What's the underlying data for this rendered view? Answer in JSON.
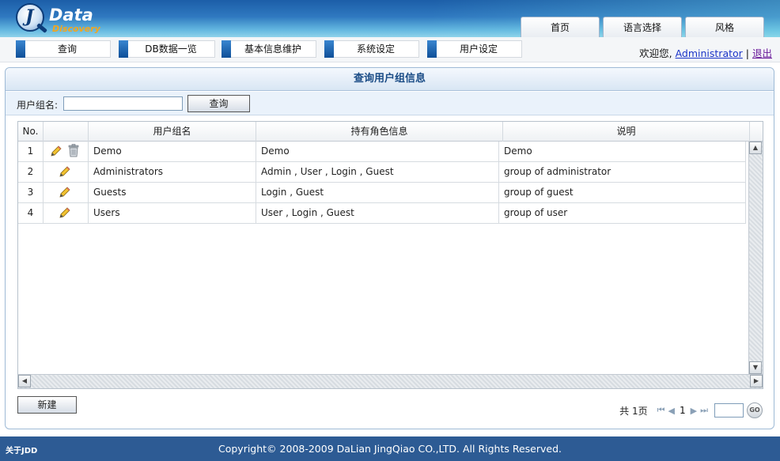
{
  "logo": {
    "word": "Data",
    "sub": "Discovery",
    "letter": "J"
  },
  "top_tabs": [
    "首页",
    "语言选择",
    "风格"
  ],
  "nav": [
    "查询",
    "DB数据一览",
    "基本信息维护",
    "系统设定",
    "用户设定"
  ],
  "welcome": {
    "prefix": "欢迎您,",
    "user": "Administrator",
    "sep": "|",
    "logout": "退出"
  },
  "panel": {
    "title": "查询用户组信息"
  },
  "search": {
    "label": "用户组名:",
    "value": "",
    "button": "查询"
  },
  "table": {
    "headers": [
      "No.",
      "",
      "用户组名",
      "持有角色信息",
      "说明"
    ],
    "rows": [
      {
        "no": "1",
        "name": "Demo",
        "roles": "Demo",
        "desc": "Demo",
        "deletable": true
      },
      {
        "no": "2",
        "name": "Administrators",
        "roles": "Admin , User , Login , Guest",
        "desc": "group of administrator",
        "deletable": false
      },
      {
        "no": "3",
        "name": "Guests",
        "roles": "Login , Guest",
        "desc": "group of guest",
        "deletable": false
      },
      {
        "no": "4",
        "name": "Users",
        "roles": "User , Login , Guest",
        "desc": "group of user",
        "deletable": false
      }
    ]
  },
  "new_button": "新建",
  "pager": {
    "total_label": "共 1页",
    "current": "1",
    "go": "GO"
  },
  "footer": {
    "about": "关于JDD",
    "copyright": "Copyright© 2008-2009 DaLian JingQiao CO.,LTD. All Rights Reserved."
  },
  "colors": {
    "header_blue": "#1c5ea8",
    "footer_blue": "#2d5b94",
    "title_text": "#1a4c86",
    "link": "#1a33c8"
  }
}
